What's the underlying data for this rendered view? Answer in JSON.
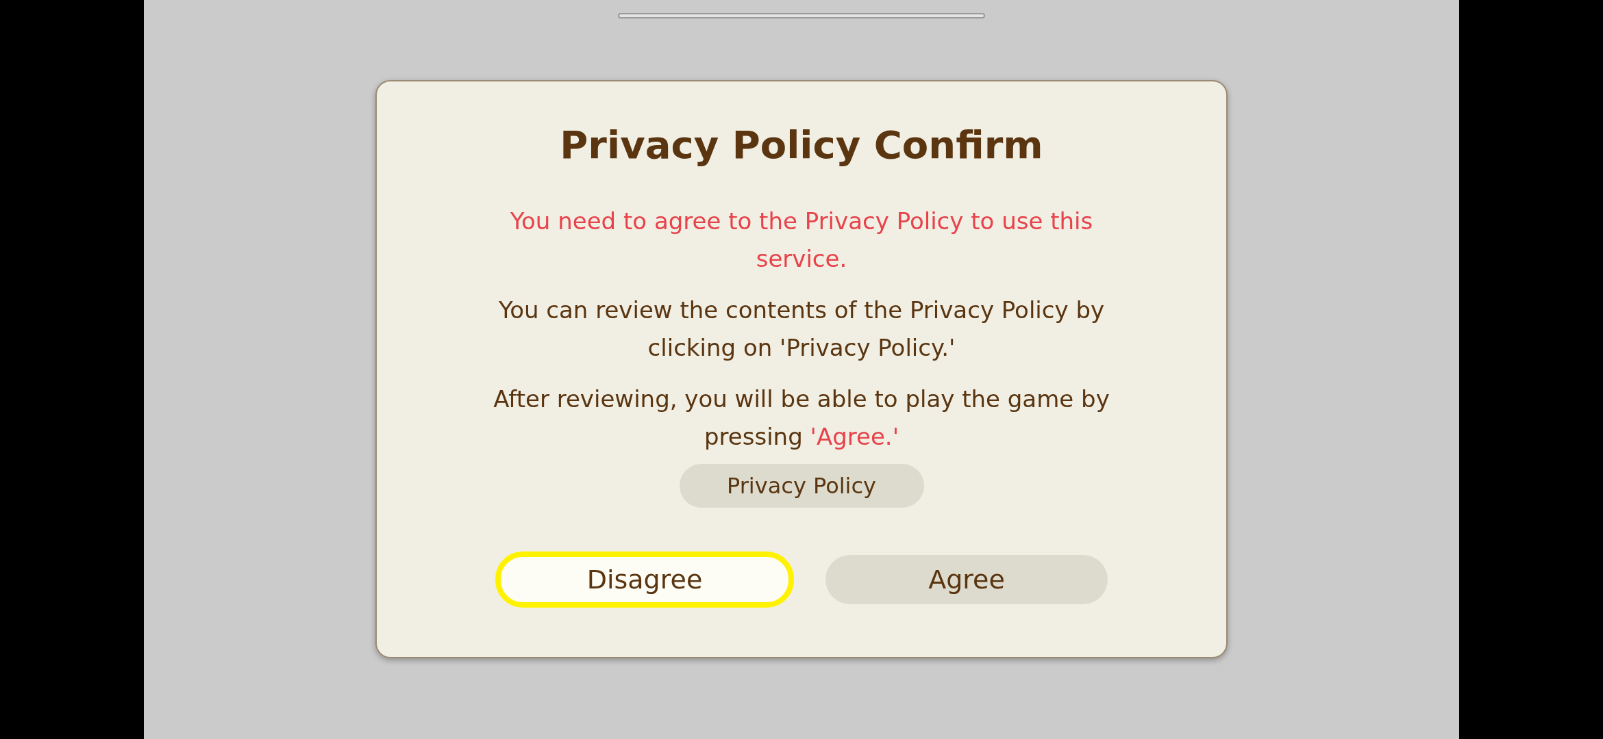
{
  "dialog": {
    "title": "Privacy Policy Confirm",
    "paragraphs": [
      {
        "parts": [
          {
            "text": "You need to agree to the Privacy Policy to use this service.",
            "kind": "warning"
          }
        ]
      },
      {
        "parts": [
          {
            "text": "You can review the contents of the Privacy Policy by clicking on 'Privacy Policy.'",
            "kind": "plain"
          }
        ]
      },
      {
        "parts": [
          {
            "text": "After reviewing, you will be able to play the game by pressing ",
            "kind": "plain"
          },
          {
            "text": "'Agree.'",
            "kind": "warning"
          }
        ]
      }
    ],
    "link_button": {
      "label": "Privacy Policy",
      "selected": false
    },
    "buttons": [
      {
        "label": "Disagree",
        "selected": true
      },
      {
        "label": "Agree",
        "selected": false
      }
    ]
  }
}
